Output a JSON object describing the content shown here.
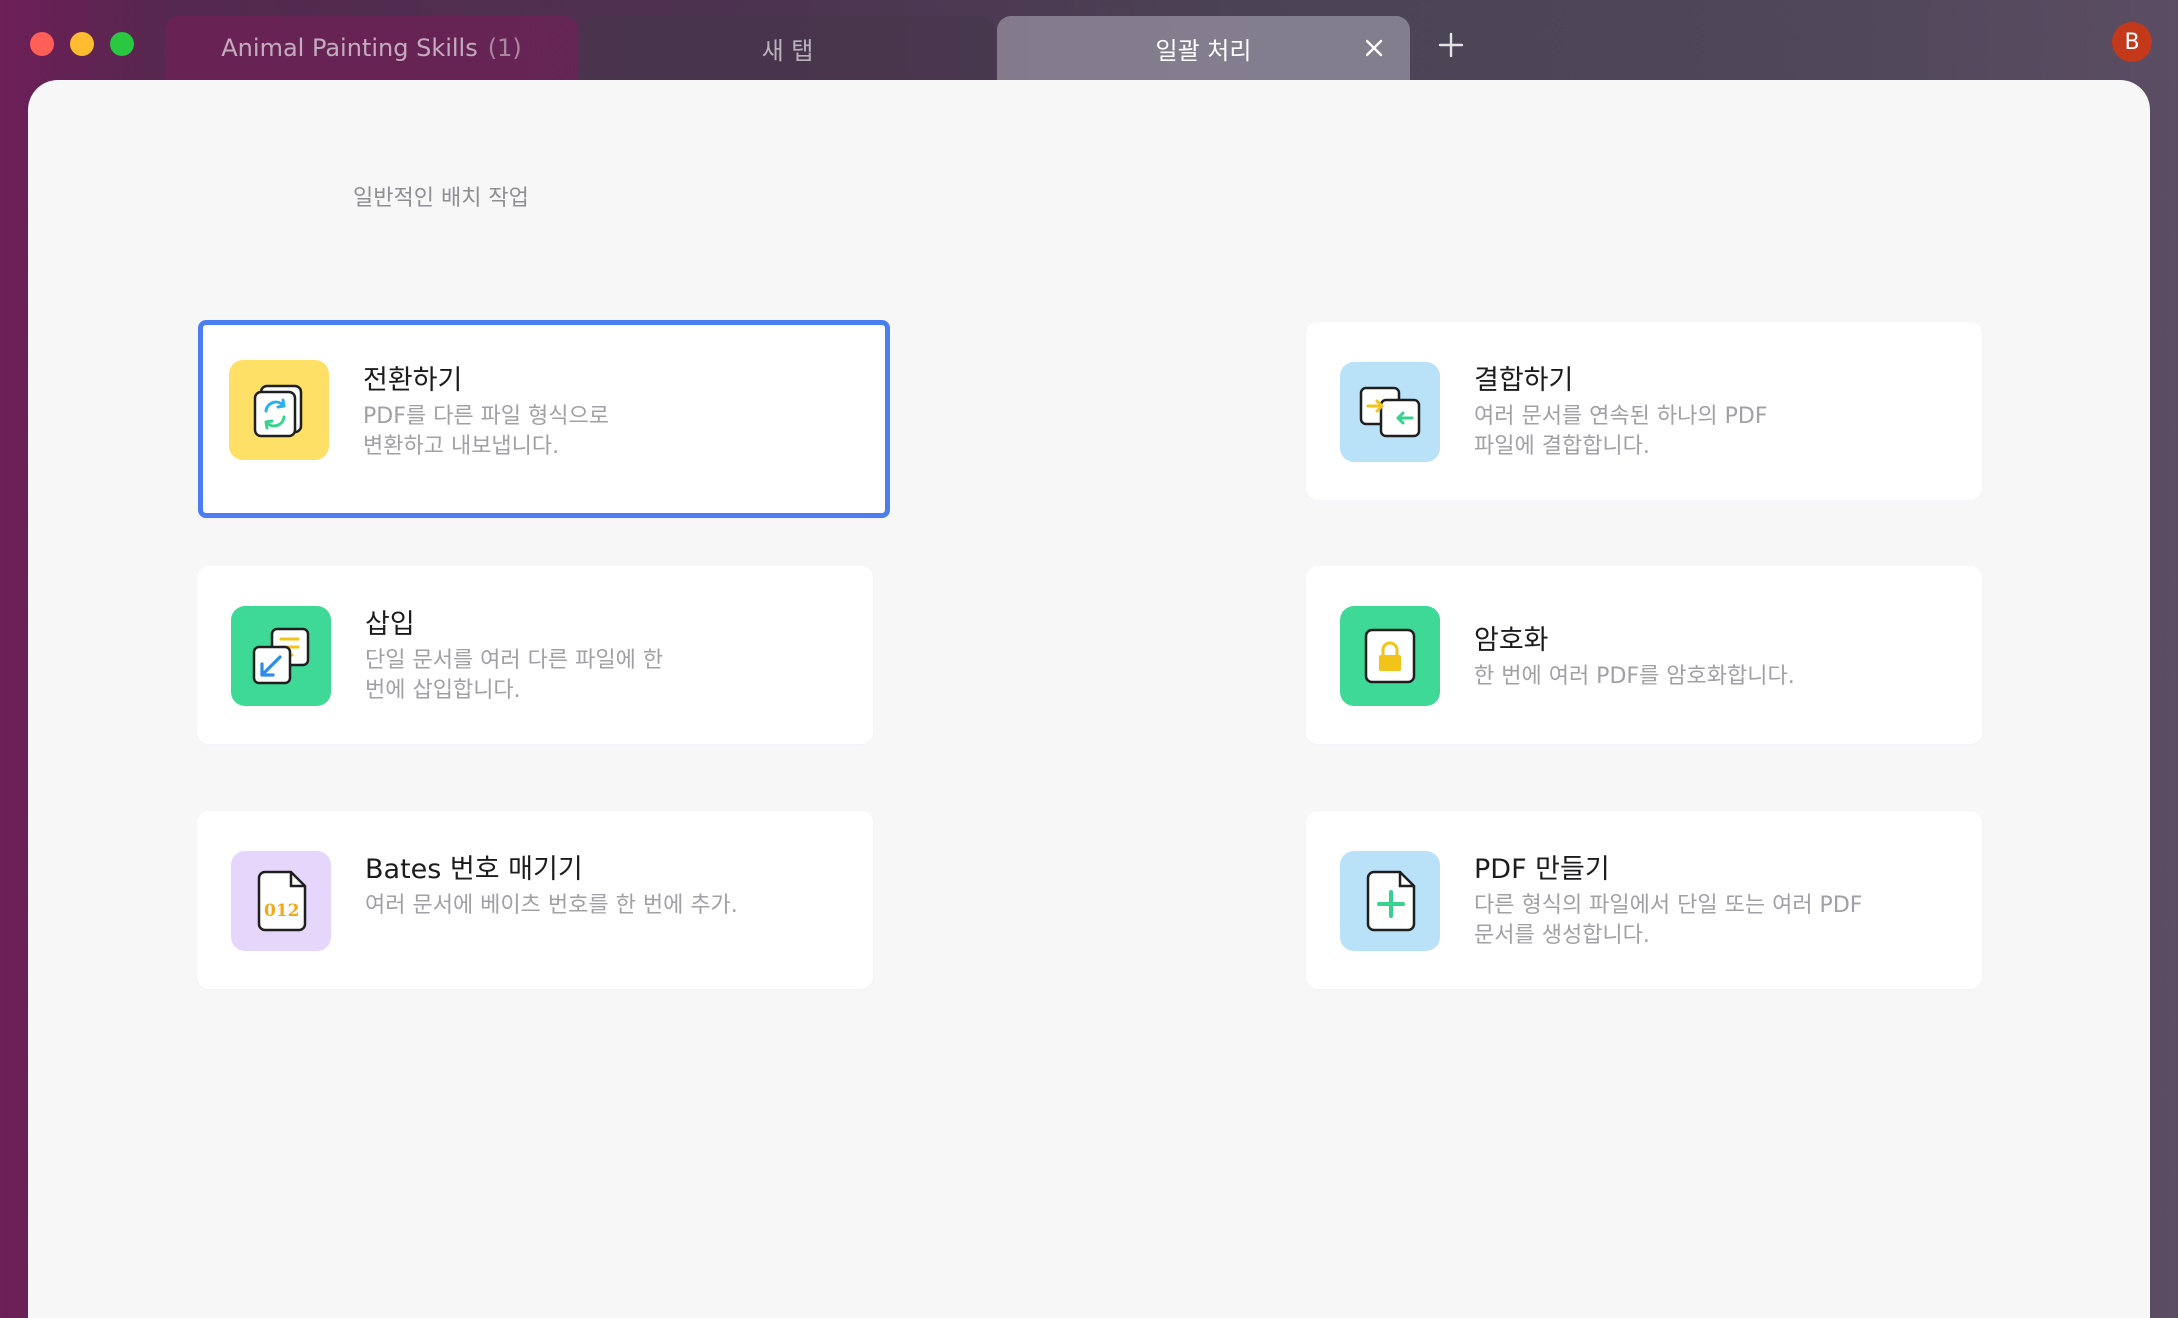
{
  "window": {
    "avatar_letter": "B"
  },
  "tabs": [
    {
      "label": "Animal Painting Skills",
      "count": "(1)"
    },
    {
      "label": "새 탭"
    },
    {
      "label": "일괄 처리",
      "active": true
    }
  ],
  "main": {
    "section_title": "일반적인 배치 작업",
    "cards": [
      {
        "title": "전환하기",
        "desc1": "PDF를 다른 파일 형식으로",
        "desc2": "변환하고 내보냅니다.",
        "icon": "convert-icon",
        "icon_bg": "#ffe066",
        "selected": true
      },
      {
        "title": "결합하기",
        "desc1": "여러 문서를 연속된 하나의 PDF",
        "desc2": "파일에 결합합니다.",
        "icon": "combine-icon",
        "icon_bg": "#b9e1f7"
      },
      {
        "title": "삽입",
        "desc1": "단일 문서를 여러 다른 파일에 한",
        "desc2": "번에 삽입합니다.",
        "icon": "insert-icon",
        "icon_bg": "#3ed996"
      },
      {
        "title": "암호화",
        "desc1": "한 번에 여러 PDF를 암호화합니다.",
        "desc2": "",
        "icon": "lock-icon",
        "icon_bg": "#3ed996"
      },
      {
        "title": "Bates 번호 매기기",
        "desc1": "여러 문서에 베이츠 번호를 한 번에 추가.",
        "desc2": "",
        "icon": "bates-number-icon",
        "icon_bg": "#e6d6fb",
        "icon_text": "012"
      },
      {
        "title": "PDF 만들기",
        "desc1": "다른 형식의 파일에서 단일 또는 여러 PDF",
        "desc2": "문서를 생성합니다.",
        "icon": "create-pdf-icon",
        "icon_bg": "#b9e1f7"
      }
    ]
  },
  "colors": {
    "selection_border": "#4b7ef0",
    "close_red": "#ff5f57",
    "minimize_yellow": "#febc2e",
    "zoom_green": "#28c840",
    "avatar_bg": "#c5391b"
  }
}
